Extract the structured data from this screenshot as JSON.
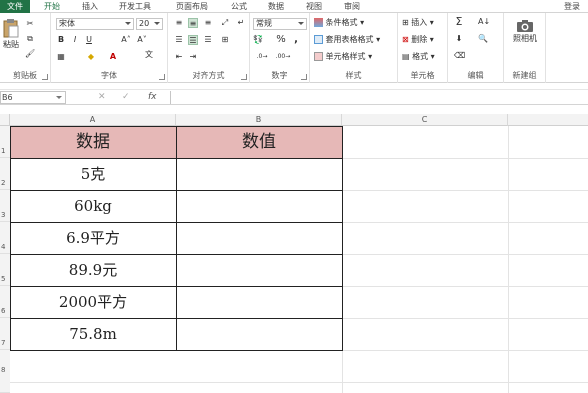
{
  "menu": {
    "file": "文件",
    "tabs": [
      "开始",
      "插入",
      "开发工具",
      "页面布局",
      "公式",
      "数据",
      "视图",
      "审阅"
    ],
    "login": "登录"
  },
  "ribbon": {
    "clipboard": {
      "paste": "粘贴",
      "label": "剪贴板"
    },
    "font": {
      "name": "宋体",
      "size": "20",
      "label": "字体"
    },
    "alignment": {
      "label": "对齐方式"
    },
    "number": {
      "format": "常规",
      "percent": "%",
      "comma": ",",
      "label": "数字"
    },
    "styles": {
      "conditional": "条件格式",
      "table": "套用表格格式",
      "cell_styles": "单元格样式",
      "label": "样式"
    },
    "cells": {
      "insert": "插入",
      "delete": "删除",
      "format": "格式",
      "label": "单元格"
    },
    "editing": {
      "label": "编辑"
    },
    "camera": {
      "button": "照相机",
      "label": "新建组"
    }
  },
  "formula_bar": {
    "name_box": "B6",
    "fx": "fx"
  },
  "columns": [
    "A",
    "B",
    "C"
  ],
  "rows": [
    "1",
    "2",
    "3",
    "4",
    "5",
    "6",
    "7",
    "8"
  ],
  "table": {
    "headers": [
      "数据",
      "数值"
    ],
    "data": [
      "5克",
      "60kg",
      "6.9平方",
      "89.9元",
      "2000平方",
      "75.8m"
    ]
  },
  "colors": {
    "accent": "#217346",
    "header_fill": "#e6b8b7"
  }
}
